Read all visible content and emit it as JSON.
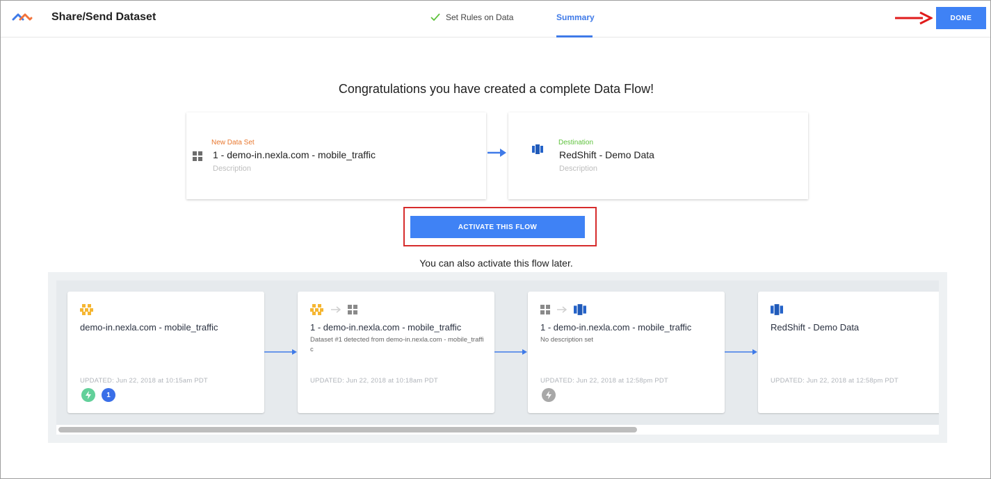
{
  "header": {
    "title": "Share/Send Dataset",
    "steps": [
      {
        "label": "Set Rules on Data",
        "state": "complete"
      },
      {
        "label": "Summary",
        "state": "active"
      }
    ],
    "done_label": "DONE"
  },
  "colors": {
    "primary": "#3f82f5",
    "active_tab": "#3f7ae8",
    "success": "#5ec23c",
    "source_kicker": "#e8772e",
    "annotation_red": "#d62b2b"
  },
  "main": {
    "congrats": "Congratulations you have created a complete Data Flow!",
    "source_card": {
      "kicker": "New Data Set",
      "name": "1 - demo-in.nexla.com - mobile_traffic",
      "description_placeholder": "Description",
      "icon": "grid-icon"
    },
    "destination_card": {
      "kicker": "Destination",
      "name": "RedShift - Demo Data",
      "description_placeholder": "Description",
      "icon": "redshift-icon"
    },
    "activate_label": "ACTIVATE THIS FLOW",
    "later_text": "You can also activate this flow later."
  },
  "flow": {
    "nodes": [
      {
        "icons": [
          "aws-s3-icon"
        ],
        "title": "demo-in.nexla.com - mobile_traffic",
        "description": "",
        "updated": "UPDATED: Jun 22, 2018 at 10:15am PDT",
        "badges": [
          {
            "kind": "lightning"
          },
          {
            "kind": "count",
            "text": "1"
          }
        ]
      },
      {
        "icons": [
          "aws-s3-icon",
          "arrow-right-icon",
          "grid-icon"
        ],
        "title": "1 - demo-in.nexla.com - mobile_traffic",
        "description": "Dataset #1 detected from demo-in.nexla.com - mobile_traffic",
        "updated": "UPDATED: Jun 22, 2018 at 10:18am PDT",
        "badges": []
      },
      {
        "icons": [
          "grid-icon",
          "arrow-right-icon",
          "redshift-icon"
        ],
        "title": "1 - demo-in.nexla.com - mobile_traffic",
        "description": "No description set",
        "updated": "UPDATED: Jun 22, 2018 at 12:58pm PDT",
        "badges": [
          {
            "kind": "lightning-inactive"
          }
        ]
      },
      {
        "icons": [
          "redshift-icon"
        ],
        "title": "RedShift - Demo Data",
        "description": "",
        "updated": "UPDATED: Jun 22, 2018 at 12:58pm PDT",
        "badges": []
      }
    ]
  }
}
